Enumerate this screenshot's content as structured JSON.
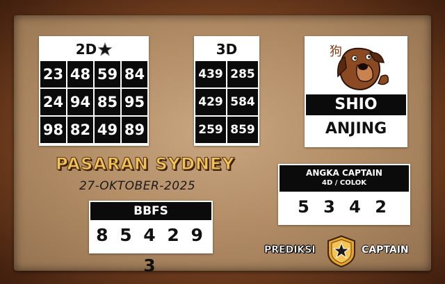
{
  "card_2d": {
    "title": "2D",
    "numbers": [
      "23",
      "48",
      "59",
      "84",
      "24",
      "94",
      "85",
      "95",
      "98",
      "82",
      "49",
      "89"
    ]
  },
  "card_3d": {
    "title": "3D",
    "numbers": [
      "439",
      "285",
      "429",
      "584",
      "259",
      "859"
    ]
  },
  "shio": {
    "label": "SHIO",
    "name": "ANJING",
    "glyph": "狗",
    "icon": "dog-icon"
  },
  "market": {
    "title": "PASARAN SYDNEY",
    "date": "27-OKTOBER-2025"
  },
  "bbfs": {
    "label": "BBFS",
    "value": "8 5 4 2 9 3"
  },
  "angka_captain": {
    "title": "ANGKA CAPTAIN",
    "subtitle": "4D / COLOK",
    "value": "5 3 4 2"
  },
  "brand": {
    "left": "PREDIKSI",
    "right": "CAPTAIN",
    "icon": "star-shield-icon"
  },
  "colors": {
    "background": "#7a4422",
    "board": "#c9a681",
    "title_gold": "#f0c25a",
    "cell_black": "#0b0b0b"
  }
}
